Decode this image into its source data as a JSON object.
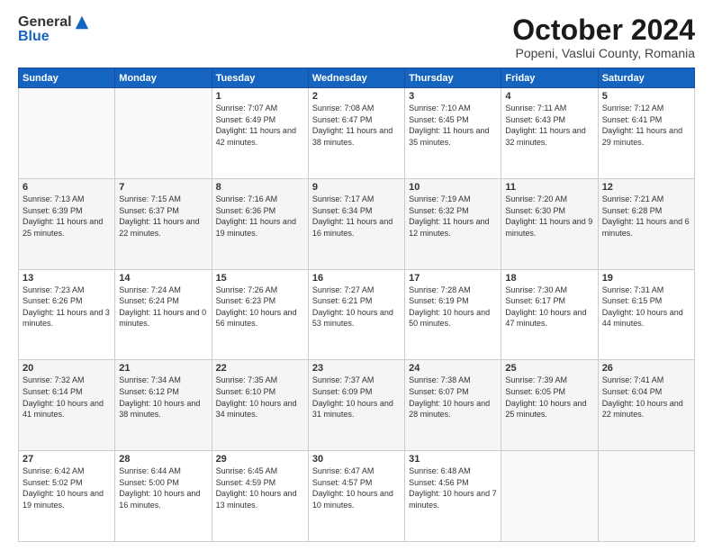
{
  "header": {
    "logo_general": "General",
    "logo_blue": "Blue",
    "month_title": "October 2024",
    "subtitle": "Popeni, Vaslui County, Romania"
  },
  "days_of_week": [
    "Sunday",
    "Monday",
    "Tuesday",
    "Wednesday",
    "Thursday",
    "Friday",
    "Saturday"
  ],
  "weeks": [
    [
      {
        "day": "",
        "info": ""
      },
      {
        "day": "",
        "info": ""
      },
      {
        "day": "1",
        "info": "Sunrise: 7:07 AM\nSunset: 6:49 PM\nDaylight: 11 hours and 42 minutes."
      },
      {
        "day": "2",
        "info": "Sunrise: 7:08 AM\nSunset: 6:47 PM\nDaylight: 11 hours and 38 minutes."
      },
      {
        "day": "3",
        "info": "Sunrise: 7:10 AM\nSunset: 6:45 PM\nDaylight: 11 hours and 35 minutes."
      },
      {
        "day": "4",
        "info": "Sunrise: 7:11 AM\nSunset: 6:43 PM\nDaylight: 11 hours and 32 minutes."
      },
      {
        "day": "5",
        "info": "Sunrise: 7:12 AM\nSunset: 6:41 PM\nDaylight: 11 hours and 29 minutes."
      }
    ],
    [
      {
        "day": "6",
        "info": "Sunrise: 7:13 AM\nSunset: 6:39 PM\nDaylight: 11 hours and 25 minutes."
      },
      {
        "day": "7",
        "info": "Sunrise: 7:15 AM\nSunset: 6:37 PM\nDaylight: 11 hours and 22 minutes."
      },
      {
        "day": "8",
        "info": "Sunrise: 7:16 AM\nSunset: 6:36 PM\nDaylight: 11 hours and 19 minutes."
      },
      {
        "day": "9",
        "info": "Sunrise: 7:17 AM\nSunset: 6:34 PM\nDaylight: 11 hours and 16 minutes."
      },
      {
        "day": "10",
        "info": "Sunrise: 7:19 AM\nSunset: 6:32 PM\nDaylight: 11 hours and 12 minutes."
      },
      {
        "day": "11",
        "info": "Sunrise: 7:20 AM\nSunset: 6:30 PM\nDaylight: 11 hours and 9 minutes."
      },
      {
        "day": "12",
        "info": "Sunrise: 7:21 AM\nSunset: 6:28 PM\nDaylight: 11 hours and 6 minutes."
      }
    ],
    [
      {
        "day": "13",
        "info": "Sunrise: 7:23 AM\nSunset: 6:26 PM\nDaylight: 11 hours and 3 minutes."
      },
      {
        "day": "14",
        "info": "Sunrise: 7:24 AM\nSunset: 6:24 PM\nDaylight: 11 hours and 0 minutes."
      },
      {
        "day": "15",
        "info": "Sunrise: 7:26 AM\nSunset: 6:23 PM\nDaylight: 10 hours and 56 minutes."
      },
      {
        "day": "16",
        "info": "Sunrise: 7:27 AM\nSunset: 6:21 PM\nDaylight: 10 hours and 53 minutes."
      },
      {
        "day": "17",
        "info": "Sunrise: 7:28 AM\nSunset: 6:19 PM\nDaylight: 10 hours and 50 minutes."
      },
      {
        "day": "18",
        "info": "Sunrise: 7:30 AM\nSunset: 6:17 PM\nDaylight: 10 hours and 47 minutes."
      },
      {
        "day": "19",
        "info": "Sunrise: 7:31 AM\nSunset: 6:15 PM\nDaylight: 10 hours and 44 minutes."
      }
    ],
    [
      {
        "day": "20",
        "info": "Sunrise: 7:32 AM\nSunset: 6:14 PM\nDaylight: 10 hours and 41 minutes."
      },
      {
        "day": "21",
        "info": "Sunrise: 7:34 AM\nSunset: 6:12 PM\nDaylight: 10 hours and 38 minutes."
      },
      {
        "day": "22",
        "info": "Sunrise: 7:35 AM\nSunset: 6:10 PM\nDaylight: 10 hours and 34 minutes."
      },
      {
        "day": "23",
        "info": "Sunrise: 7:37 AM\nSunset: 6:09 PM\nDaylight: 10 hours and 31 minutes."
      },
      {
        "day": "24",
        "info": "Sunrise: 7:38 AM\nSunset: 6:07 PM\nDaylight: 10 hours and 28 minutes."
      },
      {
        "day": "25",
        "info": "Sunrise: 7:39 AM\nSunset: 6:05 PM\nDaylight: 10 hours and 25 minutes."
      },
      {
        "day": "26",
        "info": "Sunrise: 7:41 AM\nSunset: 6:04 PM\nDaylight: 10 hours and 22 minutes."
      }
    ],
    [
      {
        "day": "27",
        "info": "Sunrise: 6:42 AM\nSunset: 5:02 PM\nDaylight: 10 hours and 19 minutes."
      },
      {
        "day": "28",
        "info": "Sunrise: 6:44 AM\nSunset: 5:00 PM\nDaylight: 10 hours and 16 minutes."
      },
      {
        "day": "29",
        "info": "Sunrise: 6:45 AM\nSunset: 4:59 PM\nDaylight: 10 hours and 13 minutes."
      },
      {
        "day": "30",
        "info": "Sunrise: 6:47 AM\nSunset: 4:57 PM\nDaylight: 10 hours and 10 minutes."
      },
      {
        "day": "31",
        "info": "Sunrise: 6:48 AM\nSunset: 4:56 PM\nDaylight: 10 hours and 7 minutes."
      },
      {
        "day": "",
        "info": ""
      },
      {
        "day": "",
        "info": ""
      }
    ]
  ]
}
